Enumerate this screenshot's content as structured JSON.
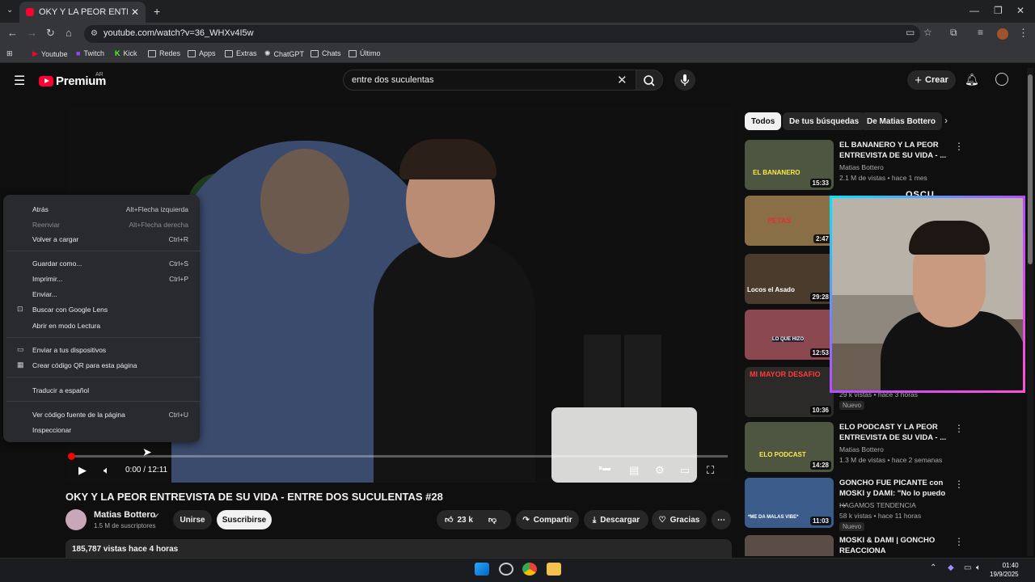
{
  "browser": {
    "tab_title": "OKY Y LA PEOR ENTREVISTA DE...",
    "url": "youtube.com/watch?v=36_WHXv4I5w",
    "bookmarks": [
      "Youtube",
      "Twitch",
      "Kick",
      "Redes",
      "Apps",
      "Extras",
      "ChatGPT",
      "Chats",
      "Último"
    ]
  },
  "header": {
    "logo_text": "Premium",
    "region": "AR",
    "search_value": "entre dos suculentas",
    "create_label": "Crear"
  },
  "player": {
    "time": "0:00 / 12:11",
    "progress_fraction": 0.0
  },
  "video": {
    "title": "OKY Y LA PEOR ENTREVISTA DE SU VIDA - ENTRE DOS SUCULENTAS #28",
    "channel": "Matias Bottero",
    "subscribers": "1.5 M de suscriptores",
    "join_label": "Unirse",
    "subscribe_label": "Suscribirse",
    "likes": "23 k",
    "share_label": "Compartir",
    "download_label": "Descargar",
    "thanks_label": "Gracias",
    "views_line": "185,787 vistas  hace 4 horas"
  },
  "chips": [
    "Todos",
    "De tus búsquedas",
    "De Matias Bottero"
  ],
  "related": [
    {
      "title": "EL BANANERO Y LA PEOR ENTREVISTA DE SU VIDA - ...",
      "channel": "Matias Bottero",
      "meta": "2.1 M de vistas • hace 1 mes",
      "duration": "15:33",
      "thumb_text": "EL BANANERO"
    },
    {
      "title": "",
      "channel": "",
      "meta": "",
      "duration": "2:47",
      "thumb_text": "PETAS"
    },
    {
      "title": "",
      "channel": "",
      "meta": "",
      "duration": "29:28",
      "thumb_text": "Locos el Asado"
    },
    {
      "title": "",
      "channel": "",
      "meta": "",
      "duration": "12:53",
      "thumb_text": "LO QUE HIZO"
    },
    {
      "title": "",
      "channel": "",
      "meta": "29 k vistas • hace 3 horas",
      "duration": "10:36",
      "thumb_text": "MI MAYOR DESAFIO",
      "badge": "Nuevo"
    },
    {
      "title": "ELO PODCAST Y LA PEOR ENTREVISTA DE SU VIDA - ...",
      "channel": "Matias Bottero",
      "meta": "1.3 M de vistas • hace 2 semanas",
      "duration": "14:28",
      "thumb_text": "ELO PODCAST"
    },
    {
      "title": "GONCHO FUE PICANTE con MOSKI y DAMI: \"No lo puedo ...",
      "channel": "HAGAMOS TENDENCIA",
      "meta": "58 k vistas • hace 11 horas",
      "duration": "11:03",
      "thumb_text": "*ME DA MALAS VIBE*",
      "badge": "Nuevo"
    },
    {
      "title": "MOSKI & DAMI | GONCHO REACCIONA",
      "channel": "",
      "meta": "",
      "duration": "",
      "thumb_text": ""
    }
  ],
  "overlay_text": "OSCU",
  "context_menu": [
    {
      "label": "Atrás",
      "shortcut": "Alt+Flecha izquierda",
      "disabled": false,
      "icon": ""
    },
    {
      "label": "Reenviar",
      "shortcut": "Alt+Flecha derecha",
      "disabled": true,
      "icon": ""
    },
    {
      "label": "Volver a cargar",
      "shortcut": "Ctrl+R",
      "disabled": false,
      "icon": ""
    },
    {
      "label": "Guardar como...",
      "shortcut": "Ctrl+S",
      "disabled": false,
      "icon": ""
    },
    {
      "label": "Imprimir...",
      "shortcut": "Ctrl+P",
      "disabled": false,
      "icon": ""
    },
    {
      "label": "Enviar...",
      "shortcut": "",
      "disabled": false,
      "icon": ""
    },
    {
      "label": "Buscar con Google Lens",
      "shortcut": "",
      "disabled": false,
      "icon": "lens-icon"
    },
    {
      "label": "Abrir en modo Lectura",
      "shortcut": "",
      "disabled": false,
      "icon": ""
    },
    {
      "label": "Enviar a tus dispositivos",
      "shortcut": "",
      "disabled": false,
      "icon": "devices-icon"
    },
    {
      "label": "Crear código QR para esta página",
      "shortcut": "",
      "disabled": false,
      "icon": "qr-icon"
    },
    {
      "label": "Traducir a español",
      "shortcut": "",
      "disabled": false,
      "icon": ""
    },
    {
      "label": "Ver código fuente de la página",
      "shortcut": "Ctrl+U",
      "disabled": false,
      "icon": ""
    },
    {
      "label": "Inspeccionar",
      "shortcut": "",
      "disabled": false,
      "icon": ""
    }
  ],
  "clock": {
    "time": "01:40",
    "date": "19/9/2025"
  },
  "colors": {
    "accent": "#ff0033",
    "bg": "#0f0f0f",
    "menu_bg": "#292a2d"
  }
}
